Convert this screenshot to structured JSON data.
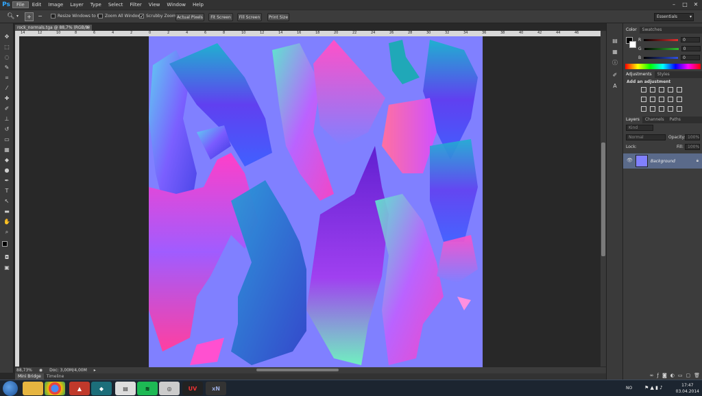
{
  "app": {
    "logo": "Ps",
    "accent": "#31a8ff"
  },
  "menu": [
    "File",
    "Edit",
    "Image",
    "Layer",
    "Type",
    "Select",
    "Filter",
    "View",
    "Window",
    "Help"
  ],
  "window_controls": [
    "–",
    "□",
    "✕"
  ],
  "options": {
    "resize_windows": "Resize Windows to Fit",
    "zoom_all": "Zoom All Windows",
    "scrubby_zoom": "Scrubby Zoom",
    "actual_pixels": "Actual Pixels",
    "fit_screen": "Fit Screen",
    "fill_screen": "Fill Screen",
    "print_size": "Print Size",
    "workspace": "Essentials",
    "resize_checked": false,
    "zoom_all_checked": false,
    "scrubby_checked": true
  },
  "document": {
    "tab_title": "rock_normals.tga @ 88,7% (RGB/8)",
    "zoom": "88,73%",
    "doc_info": "Doc: 3,00M/4,00M",
    "canvas_color": "#8080ff"
  },
  "ruler": {
    "ticks": [
      "14",
      "12",
      "10",
      "8",
      "6",
      "4",
      "2",
      "0",
      "2",
      "4",
      "6",
      "8",
      "10",
      "12",
      "14",
      "16",
      "18",
      "20",
      "22",
      "24",
      "26",
      "28",
      "30",
      "32",
      "34",
      "36",
      "38",
      "40",
      "42",
      "44",
      "46"
    ]
  },
  "bottom_tabs": [
    "Mini Bridge",
    "Timeline"
  ],
  "color_panel": {
    "tabs": [
      "Color",
      "Swatches"
    ],
    "channels": [
      {
        "label": "R",
        "value": "0",
        "color": "#e03030"
      },
      {
        "label": "G",
        "value": "0",
        "color": "#30c030"
      },
      {
        "label": "B",
        "value": "0",
        "color": "#3050e0"
      }
    ]
  },
  "adjustments_panel": {
    "tabs": [
      "Adjustments",
      "Styles"
    ],
    "heading": "Add an adjustment"
  },
  "layers_panel": {
    "tabs": [
      "Layers",
      "Channels",
      "Paths"
    ],
    "kind": "Kind",
    "blend_mode": "Normal",
    "opacity_label": "Opacity:",
    "opacity_value": "100%",
    "lock_label": "Lock:",
    "fill_label": "Fill:",
    "fill_value": "100%",
    "layer_name": "Background"
  },
  "taskbar": {
    "locale": "NO",
    "time": "17:47",
    "date": "03.04.2014"
  }
}
